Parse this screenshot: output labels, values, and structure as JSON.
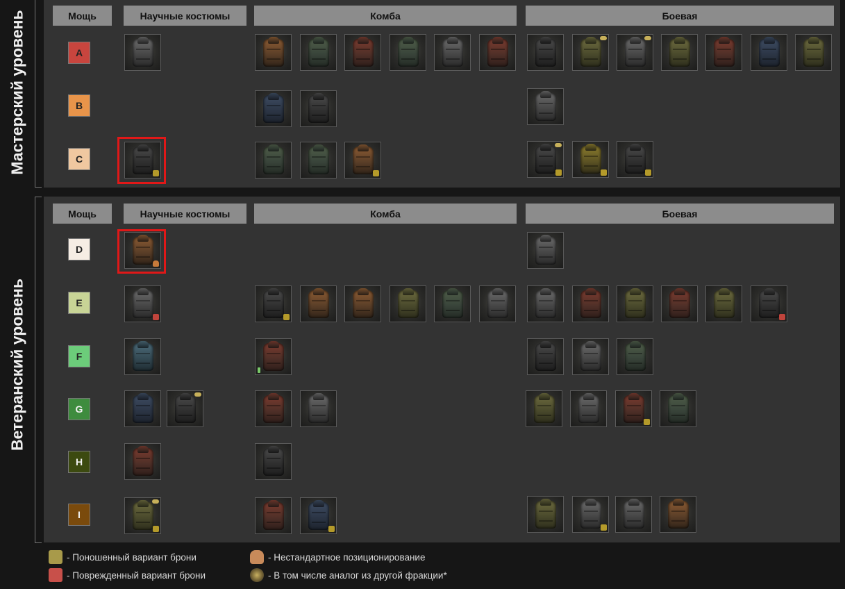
{
  "levels": {
    "master": "Мастерский уровень",
    "veteran": "Ветеранский уровень"
  },
  "headers": {
    "power": "Мощь",
    "science": "Научные костюмы",
    "combo": "Комба",
    "combat": "Боевая"
  },
  "tiers": [
    {
      "letter": "A",
      "color": "#c8453e"
    },
    {
      "letter": "B",
      "color": "#e8944a"
    },
    {
      "letter": "C",
      "color": "#f0c8a0"
    },
    {
      "letter": "D",
      "color": "#f6ede4"
    },
    {
      "letter": "E",
      "color": "#c8d496"
    },
    {
      "letter": "F",
      "color": "#6ccc7a"
    },
    {
      "letter": "G",
      "color": "#3e8c3e"
    },
    {
      "letter": "H",
      "color": "#3c4a10"
    },
    {
      "letter": "I",
      "color": "#7a4a0c"
    }
  ],
  "badge_colors": {
    "worn": "#b49a2a",
    "damaged": "#c0443c",
    "nonstandard": "#c77a3a",
    "highlight": "#e01818"
  },
  "legend": {
    "worn": "- Поношенный вариант брони",
    "damaged": "- Поврежденный вариант брони",
    "nonstandard": "- Нестандартное позиционирование",
    "analog": "- В том числе аналог из другой фракции*"
  }
}
